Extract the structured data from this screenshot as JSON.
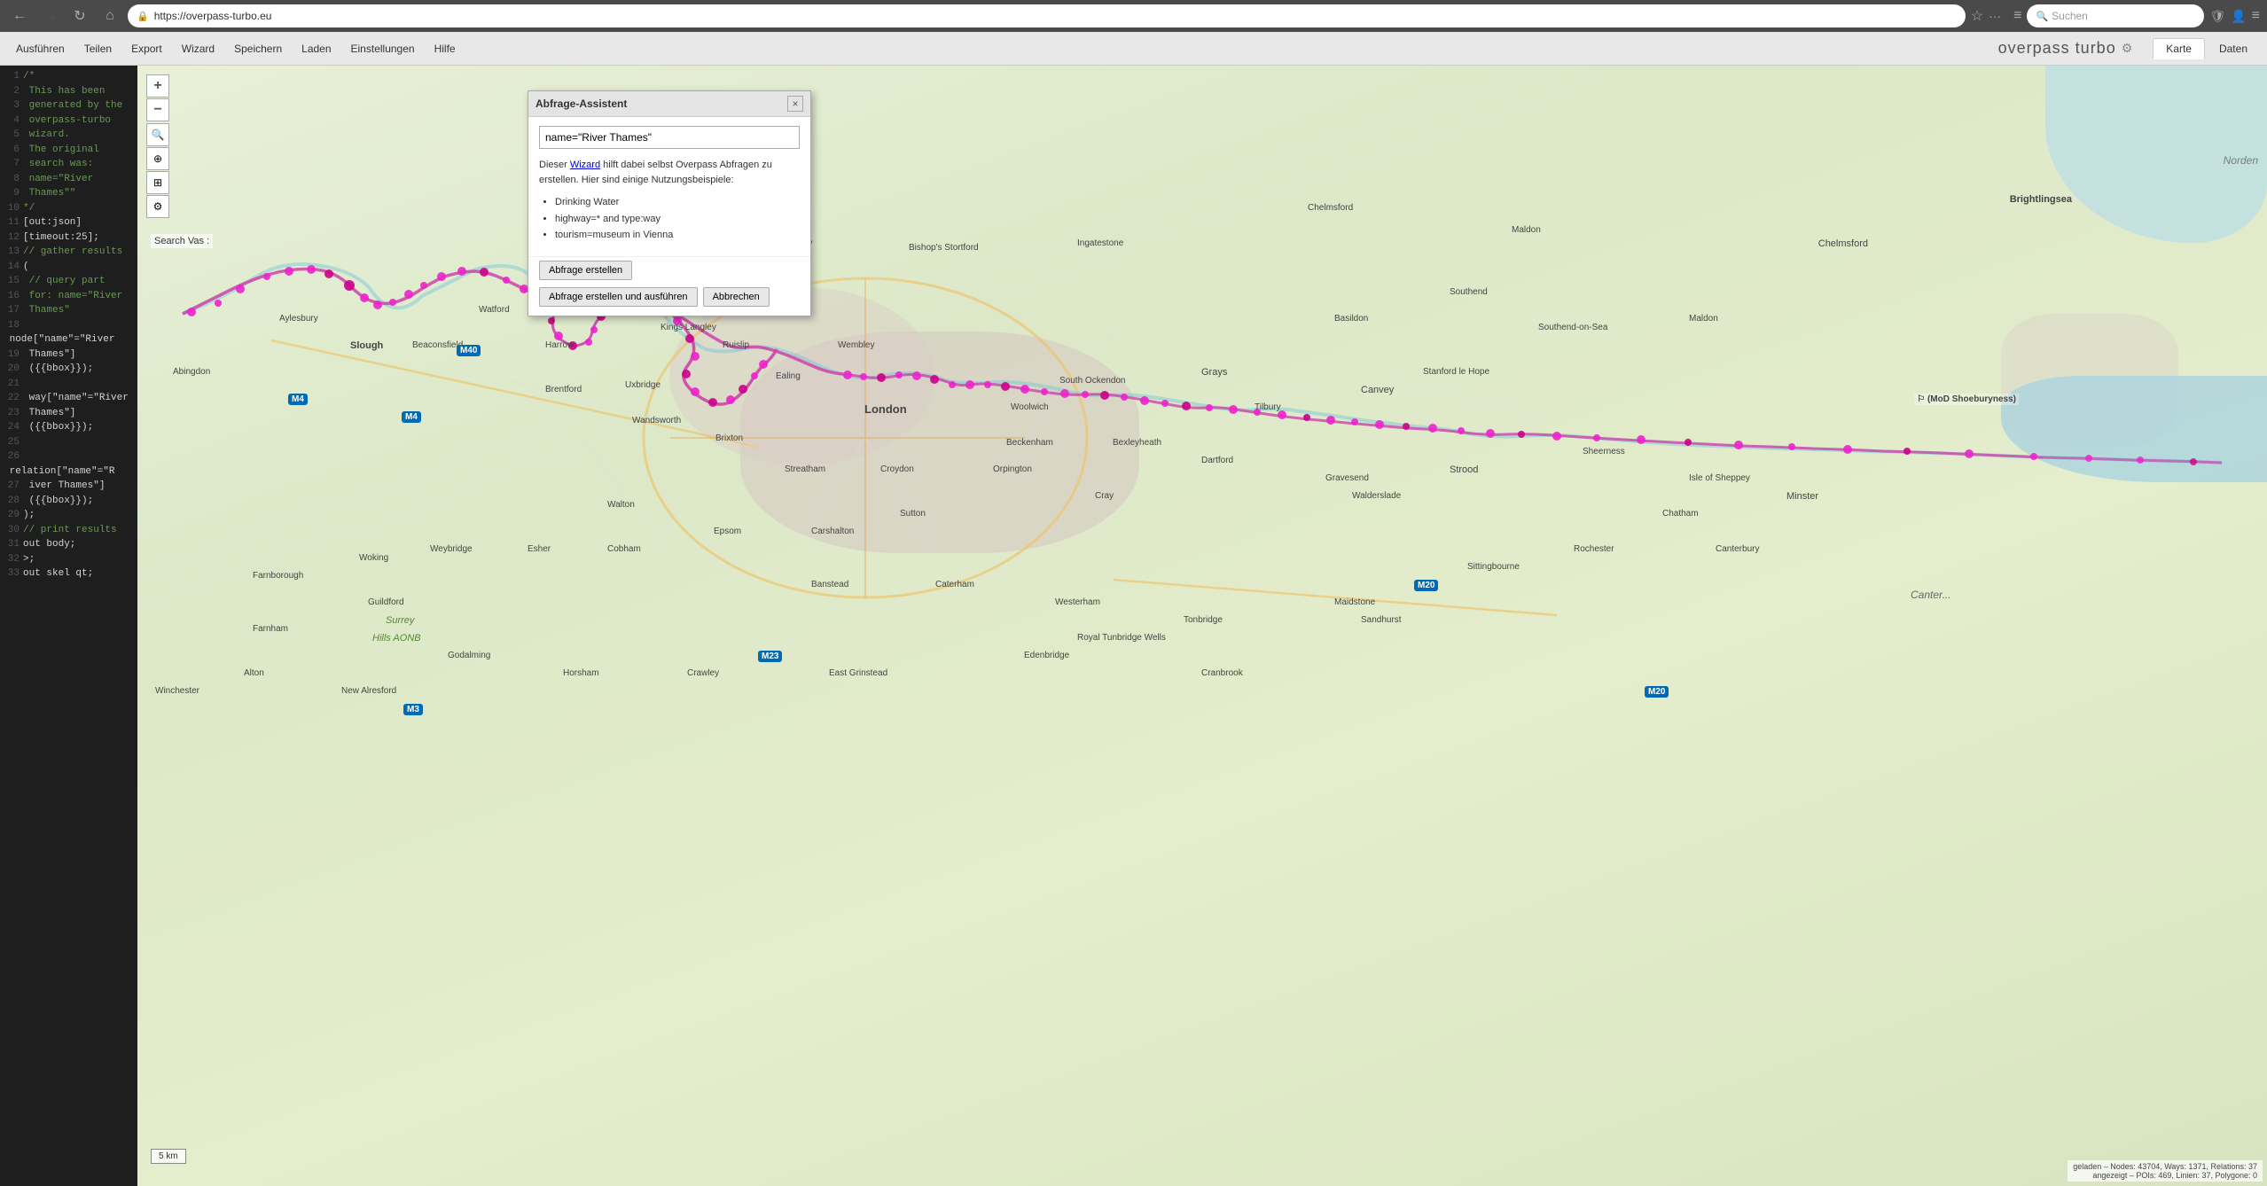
{
  "browser": {
    "back_btn": "←",
    "forward_btn": "→",
    "refresh_btn": "↻",
    "home_btn": "⌂",
    "url": "https://overpass-turbo.eu",
    "lock_icon": "🔒",
    "menu_icon": "···",
    "bookmark_icon": "☆",
    "search_placeholder": "Suchen",
    "sidebar_icon": "≡",
    "tab_icon": "⬜",
    "shield_icon": "🛡",
    "profile_icon": "👤",
    "more_icon": "≡"
  },
  "toolbar": {
    "run_label": "Ausführen",
    "share_label": "Teilen",
    "export_label": "Export",
    "wizard_label": "Wizard",
    "save_label": "Speichern",
    "load_label": "Laden",
    "settings_label": "Einstellungen",
    "help_label": "Hilfe",
    "app_title": "overpass turbo",
    "tab_map": "Karte",
    "tab_data": "Daten"
  },
  "code": {
    "lines": [
      {
        "num": 1,
        "text": "/*",
        "type": "comment"
      },
      {
        "num": 2,
        "text": " This has been",
        "type": "comment"
      },
      {
        "num": 3,
        "text": " generated by the",
        "type": "comment"
      },
      {
        "num": 4,
        "text": " overpass-turbo",
        "type": "comment"
      },
      {
        "num": 5,
        "text": " wizard.",
        "type": "comment"
      },
      {
        "num": 6,
        "text": " The original",
        "type": "comment"
      },
      {
        "num": 7,
        "text": " search was:",
        "type": "comment"
      },
      {
        "num": 8,
        "text": " name=\"River",
        "type": "comment"
      },
      {
        "num": 9,
        "text": " Thames\"",
        "type": "comment"
      },
      {
        "num": 10,
        "text": "*/",
        "type": "comment"
      },
      {
        "num": 11,
        "text": "[out:json]",
        "type": "code"
      },
      {
        "num": 12,
        "text": "[timeout:25];",
        "type": "code"
      },
      {
        "num": 13,
        "text": "// gather results",
        "type": "comment"
      },
      {
        "num": 14,
        "text": "(",
        "type": "code"
      },
      {
        "num": 15,
        "text": "  // query part",
        "type": "comment"
      },
      {
        "num": 16,
        "text": "  for: name=\"River",
        "type": "comment"
      },
      {
        "num": 17,
        "text": "  Thames\"",
        "type": "comment"
      },
      {
        "num": 18,
        "text": "  node[\"name\"=\"River",
        "type": "code"
      },
      {
        "num": 19,
        "text": "  Thames\"]",
        "type": "code"
      },
      {
        "num": 20,
        "text": "  ({{bbox}});",
        "type": "code"
      },
      {
        "num": 21,
        "text": "",
        "type": "code"
      },
      {
        "num": 22,
        "text": "  way[\"name\"=\"River",
        "type": "code"
      },
      {
        "num": 23,
        "text": "  Thames\"]",
        "type": "code"
      },
      {
        "num": 24,
        "text": "  ({{bbox}});",
        "type": "code"
      },
      {
        "num": 25,
        "text": "",
        "type": "code"
      },
      {
        "num": 26,
        "text": "  relation[\"name\"=\"R",
        "type": "code"
      },
      {
        "num": 27,
        "text": "  iver Thames\"]",
        "type": "code"
      },
      {
        "num": 28,
        "text": "  ({{bbox}});",
        "type": "code"
      },
      {
        "num": 29,
        "text": ");",
        "type": "code"
      },
      {
        "num": 30,
        "text": "// print results",
        "type": "comment"
      },
      {
        "num": 31,
        "text": "out body;",
        "type": "code"
      },
      {
        "num": 32,
        "text": ">;",
        "type": "code"
      },
      {
        "num": 33,
        "text": "out skel qt;",
        "type": "code"
      }
    ]
  },
  "map": {
    "zoom_in": "+",
    "zoom_out": "−",
    "search_label": "Search Vas :",
    "scale_label": "5 km",
    "attribution": "geladen – Nodes: 43704, Ways: 1371, Relations: 37\nangezeigt – POIs: 469, Linien: 37, Polygone: 0"
  },
  "dialog": {
    "title": "Abfrage-Assistent",
    "close_label": "×",
    "input_value": "name=\"River Thames\"",
    "description_pre": "Dieser ",
    "wizard_link": "Wizard",
    "description_post": " hilft dabei selbst Overpass Abfragen zu erstellen. Hier sind einige Nutzungsbeispiele:",
    "examples": [
      "Drinking Water",
      "highway=* and type:way",
      "tourism=museum in Vienna"
    ],
    "btn_create": "Abfrage erstellen",
    "btn_create_run": "Abfrage erstellen und ausführen",
    "btn_cancel": "Abbrechen"
  }
}
